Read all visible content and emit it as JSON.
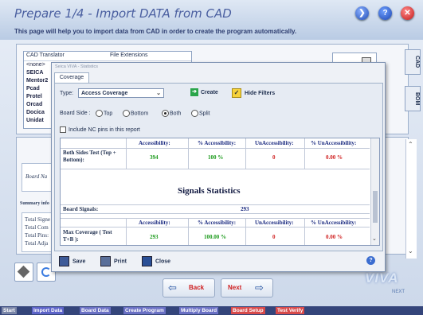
{
  "header": {
    "title": "Prepare 1/4 - Import DATA from CAD",
    "subtitle": "This page will help you to import data from CAD in order to create the program automatically."
  },
  "cad_list": {
    "col1": "CAD Translator",
    "col2": "File Extensions",
    "items": [
      "<none>",
      "SEICA",
      "Mentor2",
      "Pcad",
      "Protel",
      "Orcad",
      "Docica",
      "Unidat"
    ]
  },
  "side_tabs": [
    "CAD",
    "BOM"
  ],
  "background": {
    "board_name": "Board Na",
    "summary": "Summary info",
    "totals": [
      "Total Signe",
      "Total Com",
      "Total Pins:",
      "Total Adja"
    ]
  },
  "dialog": {
    "title": "Seica VIVA - Statistics",
    "tab": "Coverage",
    "type_label": "Type:",
    "type_value": "Access Coverage",
    "create_label": "Create",
    "hide_filters_label": "Hide Filters",
    "board_side_label": "Board Side :",
    "board_side_options": [
      "Top",
      "Bottom",
      "Both",
      "Split"
    ],
    "board_side_selected": "Both",
    "nc_pins_label": "Include NC pins in this report",
    "report": {
      "row1_label": "Both Sides Test (Top + Bottom):",
      "headers": [
        "Accessibility:",
        "% Accessibility:",
        "UnAccessibility:",
        "% UnAccessibility:"
      ],
      "row1_values": [
        "394",
        "100 %",
        "0",
        "0.00 %"
      ],
      "section_title": "Signals Statistics",
      "board_signals_label": "Board Signals:",
      "board_signals_value": "293",
      "max_label": "Max Coverage ( Test T+B ):",
      "max_values": [
        "293",
        "100.00 %",
        "0",
        "0.00 %"
      ]
    },
    "footer": {
      "save": "Save",
      "print": "Print",
      "close": "Close"
    }
  },
  "wizard": {
    "back": "Back",
    "next": "Next"
  },
  "logo": "VIVA",
  "logo_sub": "NEXT",
  "steps": [
    {
      "label": "Start",
      "color": "#7a86a8"
    },
    {
      "label": "Import Data",
      "color": "#5c63c8"
    },
    {
      "label": "Board Data",
      "color": "#6a70c4"
    },
    {
      "label": "Create Program",
      "color": "#6a70c4"
    },
    {
      "label": "Multiply Board",
      "color": "#6a70c4"
    },
    {
      "label": "Board Setup",
      "color": "#d84a4a"
    },
    {
      "label": "Test Verify",
      "color": "#d84a4a"
    }
  ]
}
